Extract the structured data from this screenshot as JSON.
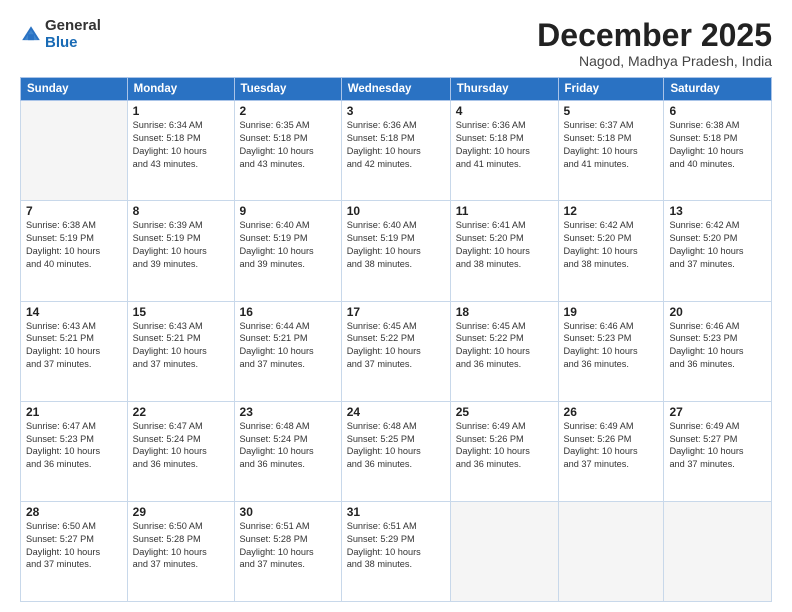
{
  "logo": {
    "general": "General",
    "blue": "Blue"
  },
  "title": "December 2025",
  "subtitle": "Nagod, Madhya Pradesh, India",
  "header_days": [
    "Sunday",
    "Monday",
    "Tuesday",
    "Wednesday",
    "Thursday",
    "Friday",
    "Saturday"
  ],
  "weeks": [
    [
      {
        "day": "",
        "info": ""
      },
      {
        "day": "1",
        "info": "Sunrise: 6:34 AM\nSunset: 5:18 PM\nDaylight: 10 hours\nand 43 minutes."
      },
      {
        "day": "2",
        "info": "Sunrise: 6:35 AM\nSunset: 5:18 PM\nDaylight: 10 hours\nand 43 minutes."
      },
      {
        "day": "3",
        "info": "Sunrise: 6:36 AM\nSunset: 5:18 PM\nDaylight: 10 hours\nand 42 minutes."
      },
      {
        "day": "4",
        "info": "Sunrise: 6:36 AM\nSunset: 5:18 PM\nDaylight: 10 hours\nand 41 minutes."
      },
      {
        "day": "5",
        "info": "Sunrise: 6:37 AM\nSunset: 5:18 PM\nDaylight: 10 hours\nand 41 minutes."
      },
      {
        "day": "6",
        "info": "Sunrise: 6:38 AM\nSunset: 5:18 PM\nDaylight: 10 hours\nand 40 minutes."
      }
    ],
    [
      {
        "day": "7",
        "info": "Sunrise: 6:38 AM\nSunset: 5:19 PM\nDaylight: 10 hours\nand 40 minutes."
      },
      {
        "day": "8",
        "info": "Sunrise: 6:39 AM\nSunset: 5:19 PM\nDaylight: 10 hours\nand 39 minutes."
      },
      {
        "day": "9",
        "info": "Sunrise: 6:40 AM\nSunset: 5:19 PM\nDaylight: 10 hours\nand 39 minutes."
      },
      {
        "day": "10",
        "info": "Sunrise: 6:40 AM\nSunset: 5:19 PM\nDaylight: 10 hours\nand 38 minutes."
      },
      {
        "day": "11",
        "info": "Sunrise: 6:41 AM\nSunset: 5:20 PM\nDaylight: 10 hours\nand 38 minutes."
      },
      {
        "day": "12",
        "info": "Sunrise: 6:42 AM\nSunset: 5:20 PM\nDaylight: 10 hours\nand 38 minutes."
      },
      {
        "day": "13",
        "info": "Sunrise: 6:42 AM\nSunset: 5:20 PM\nDaylight: 10 hours\nand 37 minutes."
      }
    ],
    [
      {
        "day": "14",
        "info": "Sunrise: 6:43 AM\nSunset: 5:21 PM\nDaylight: 10 hours\nand 37 minutes."
      },
      {
        "day": "15",
        "info": "Sunrise: 6:43 AM\nSunset: 5:21 PM\nDaylight: 10 hours\nand 37 minutes."
      },
      {
        "day": "16",
        "info": "Sunrise: 6:44 AM\nSunset: 5:21 PM\nDaylight: 10 hours\nand 37 minutes."
      },
      {
        "day": "17",
        "info": "Sunrise: 6:45 AM\nSunset: 5:22 PM\nDaylight: 10 hours\nand 37 minutes."
      },
      {
        "day": "18",
        "info": "Sunrise: 6:45 AM\nSunset: 5:22 PM\nDaylight: 10 hours\nand 36 minutes."
      },
      {
        "day": "19",
        "info": "Sunrise: 6:46 AM\nSunset: 5:23 PM\nDaylight: 10 hours\nand 36 minutes."
      },
      {
        "day": "20",
        "info": "Sunrise: 6:46 AM\nSunset: 5:23 PM\nDaylight: 10 hours\nand 36 minutes."
      }
    ],
    [
      {
        "day": "21",
        "info": "Sunrise: 6:47 AM\nSunset: 5:23 PM\nDaylight: 10 hours\nand 36 minutes."
      },
      {
        "day": "22",
        "info": "Sunrise: 6:47 AM\nSunset: 5:24 PM\nDaylight: 10 hours\nand 36 minutes."
      },
      {
        "day": "23",
        "info": "Sunrise: 6:48 AM\nSunset: 5:24 PM\nDaylight: 10 hours\nand 36 minutes."
      },
      {
        "day": "24",
        "info": "Sunrise: 6:48 AM\nSunset: 5:25 PM\nDaylight: 10 hours\nand 36 minutes."
      },
      {
        "day": "25",
        "info": "Sunrise: 6:49 AM\nSunset: 5:26 PM\nDaylight: 10 hours\nand 36 minutes."
      },
      {
        "day": "26",
        "info": "Sunrise: 6:49 AM\nSunset: 5:26 PM\nDaylight: 10 hours\nand 37 minutes."
      },
      {
        "day": "27",
        "info": "Sunrise: 6:49 AM\nSunset: 5:27 PM\nDaylight: 10 hours\nand 37 minutes."
      }
    ],
    [
      {
        "day": "28",
        "info": "Sunrise: 6:50 AM\nSunset: 5:27 PM\nDaylight: 10 hours\nand 37 minutes."
      },
      {
        "day": "29",
        "info": "Sunrise: 6:50 AM\nSunset: 5:28 PM\nDaylight: 10 hours\nand 37 minutes."
      },
      {
        "day": "30",
        "info": "Sunrise: 6:51 AM\nSunset: 5:28 PM\nDaylight: 10 hours\nand 37 minutes."
      },
      {
        "day": "31",
        "info": "Sunrise: 6:51 AM\nSunset: 5:29 PM\nDaylight: 10 hours\nand 38 minutes."
      },
      {
        "day": "",
        "info": ""
      },
      {
        "day": "",
        "info": ""
      },
      {
        "day": "",
        "info": ""
      }
    ]
  ]
}
